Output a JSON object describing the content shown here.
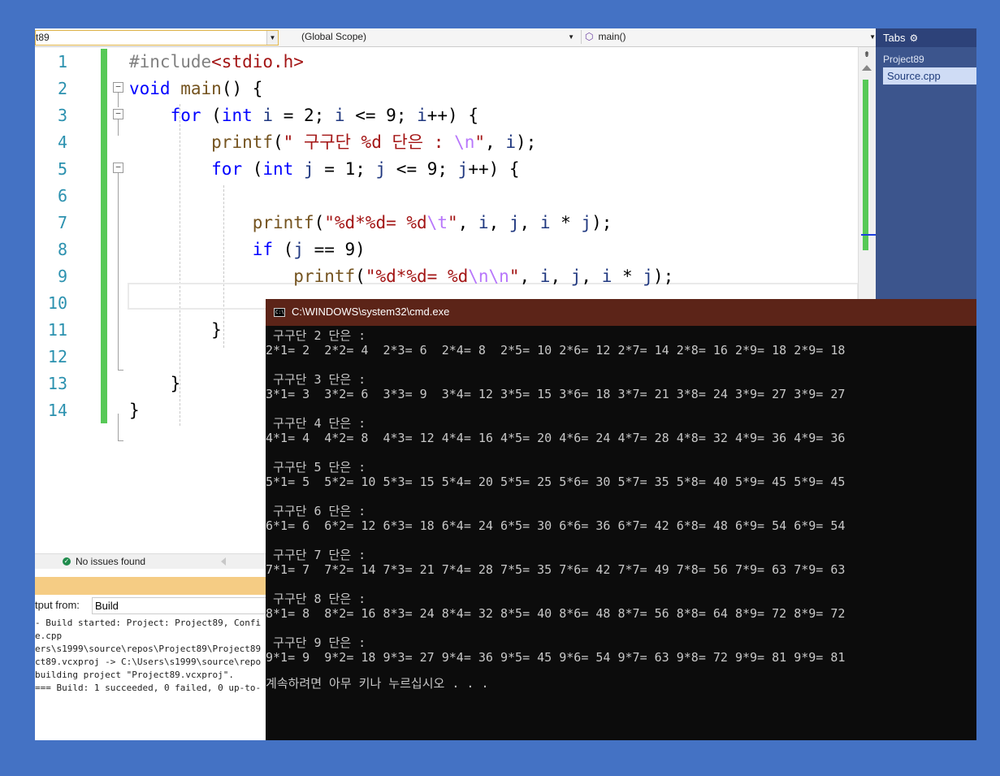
{
  "navbar": {
    "project_combo": "t89",
    "scope_combo": "(Global Scope)",
    "member_combo": "main()"
  },
  "editor": {
    "line_numbers": [
      "1",
      "2",
      "3",
      "4",
      "5",
      "6",
      "7",
      "8",
      "9",
      "10",
      "11",
      "12",
      "13",
      "14"
    ],
    "code_lines": [
      "#include<stdio.h>",
      "void main() {",
      "    for (int i = 2; i <= 9; i++) {",
      "        printf(\" 구구단 %d 단은 : \\n\", i);",
      "        for (int j = 1; j <= 9; j++) {",
      "",
      "            printf(\"%d*%d= %d\\t\", i, j, i * j);",
      "            if (j == 9)",
      "                printf(\"%d*%d= %d\\n\\n\", i, j, i * j);",
      "",
      "        }",
      "",
      "    }",
      "}"
    ]
  },
  "status": {
    "issues_text": "No issues found"
  },
  "output": {
    "from_label": "tput from:",
    "source_value": "Build",
    "lines": [
      "- Build started: Project: Project89, Confi",
      "e.cpp",
      "ers\\s1999\\source\\repos\\Project89\\Project89",
      "ct89.vcxproj -> C:\\Users\\s1999\\source\\repo",
      "building project \"Project89.vcxproj\".",
      "=== Build: 1 succeeded, 0 failed, 0 up-to-"
    ]
  },
  "tabs": {
    "header": "Tabs",
    "project": "Project89",
    "file": "Source.cpp"
  },
  "console": {
    "title": "C:\\WINDOWS\\system32\\cmd.exe",
    "lines": [
      " 구구단 2 단은 :",
      "2*1= 2  2*2= 4  2*3= 6  2*4= 8  2*5= 10 2*6= 12 2*7= 14 2*8= 16 2*9= 18 2*9= 18",
      "",
      " 구구단 3 단은 :",
      "3*1= 3  3*2= 6  3*3= 9  3*4= 12 3*5= 15 3*6= 18 3*7= 21 3*8= 24 3*9= 27 3*9= 27",
      "",
      " 구구단 4 단은 :",
      "4*1= 4  4*2= 8  4*3= 12 4*4= 16 4*5= 20 4*6= 24 4*7= 28 4*8= 32 4*9= 36 4*9= 36",
      "",
      " 구구단 5 단은 :",
      "5*1= 5  5*2= 10 5*3= 15 5*4= 20 5*5= 25 5*6= 30 5*7= 35 5*8= 40 5*9= 45 5*9= 45",
      "",
      " 구구단 6 단은 :",
      "6*1= 6  6*2= 12 6*3= 18 6*4= 24 6*5= 30 6*6= 36 6*7= 42 6*8= 48 6*9= 54 6*9= 54",
      "",
      " 구구단 7 단은 :",
      "7*1= 7  7*2= 14 7*3= 21 7*4= 28 7*5= 35 7*6= 42 7*7= 49 7*8= 56 7*9= 63 7*9= 63",
      "",
      " 구구단 8 단은 :",
      "8*1= 8  8*2= 16 8*3= 24 8*4= 32 8*5= 40 8*6= 48 8*7= 56 8*8= 64 8*9= 72 8*9= 72",
      "",
      " 구구단 9 단은 :",
      "9*1= 9  9*2= 18 9*3= 27 9*4= 36 9*5= 45 9*6= 54 9*7= 63 9*8= 72 9*9= 81 9*9= 81",
      "",
      "계속하려면 아무 키나 누르십시오 . . ."
    ]
  },
  "colors": {
    "desktop": "#4472c4",
    "change_bar": "#57c957",
    "keyword": "#0000ff",
    "string": "#a31515",
    "escape": "#b776fb",
    "variable": "#1f377f",
    "console_title": "#5c2418",
    "tabs_panel": "#3c558d",
    "output_title": "#f5cc84"
  }
}
